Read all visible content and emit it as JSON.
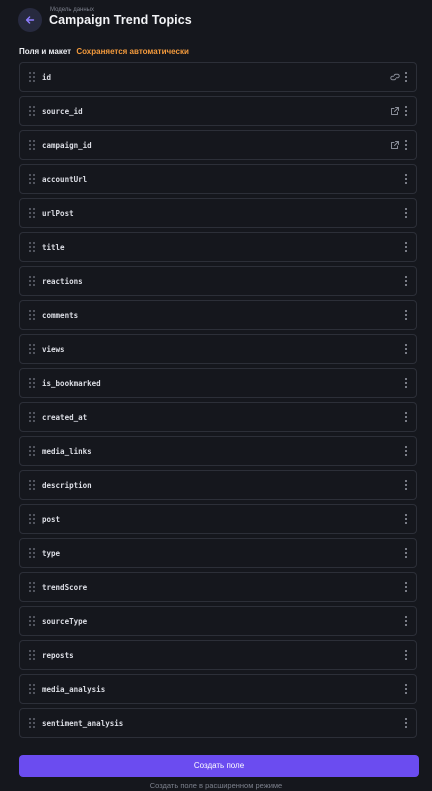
{
  "header": {
    "subtitle": "Модель данных",
    "title": "Campaign Trend Topics",
    "back_icon": "arrow-left-icon"
  },
  "section": {
    "label": "Поля и макет",
    "autosave": "Сохраняется автоматически"
  },
  "fields": [
    {
      "name": "id",
      "icon": "link-icon"
    },
    {
      "name": "source_id",
      "icon": "external-link-icon"
    },
    {
      "name": "campaign_id",
      "icon": "external-link-icon"
    },
    {
      "name": "accountUrl",
      "icon": ""
    },
    {
      "name": "urlPost",
      "icon": ""
    },
    {
      "name": "title",
      "icon": ""
    },
    {
      "name": "reactions",
      "icon": ""
    },
    {
      "name": "comments",
      "icon": ""
    },
    {
      "name": "views",
      "icon": ""
    },
    {
      "name": "is_bookmarked",
      "icon": ""
    },
    {
      "name": "created_at",
      "icon": ""
    },
    {
      "name": "media_links",
      "icon": ""
    },
    {
      "name": "description",
      "icon": ""
    },
    {
      "name": "post",
      "icon": ""
    },
    {
      "name": "type",
      "icon": ""
    },
    {
      "name": "trendScore",
      "icon": ""
    },
    {
      "name": "sourceType",
      "icon": ""
    },
    {
      "name": "reposts",
      "icon": ""
    },
    {
      "name": "media_analysis",
      "icon": ""
    },
    {
      "name": "sentiment_analysis",
      "icon": ""
    }
  ],
  "actions": {
    "create_label": "Создать поле",
    "advanced_label": "Создать поле в расширенном режиме"
  },
  "colors": {
    "background": "#15171d",
    "accent": "#6b4cf0",
    "autosave": "#f39a3c",
    "row_border": "#2c2f38"
  }
}
